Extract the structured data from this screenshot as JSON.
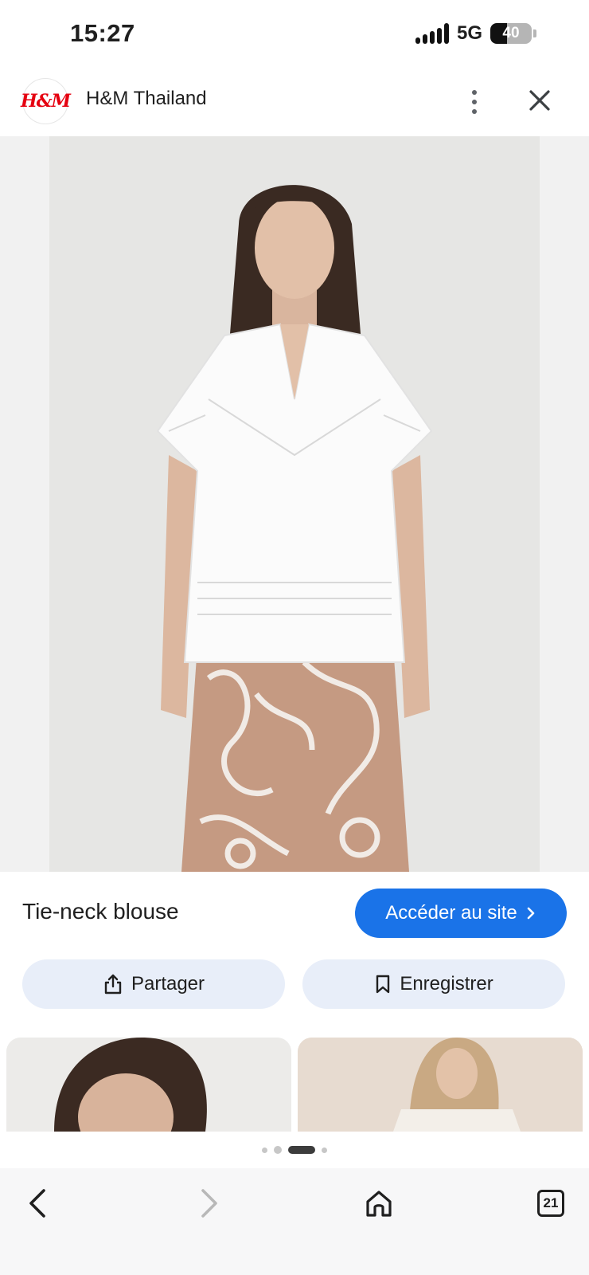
{
  "status_bar": {
    "time": "15:27",
    "network": "5G",
    "battery": "40",
    "battery_level_percent": 40
  },
  "header": {
    "logo_text": "H&M",
    "site_name": "H&M Thailand",
    "menu_icon": "more-vert-icon",
    "close_icon": "close-icon"
  },
  "product": {
    "title": "Tie-neck blouse",
    "visit_button": "Accéder au site",
    "share_button": "Partager",
    "save_button": "Enregistrer"
  },
  "pager": {
    "page_count": 4,
    "active_index": 2
  },
  "bottom_nav": {
    "tabs_count": "21"
  },
  "colors": {
    "accent": "#1a73e8",
    "action_bg": "#e8eef9",
    "brand_red": "#e50010"
  }
}
